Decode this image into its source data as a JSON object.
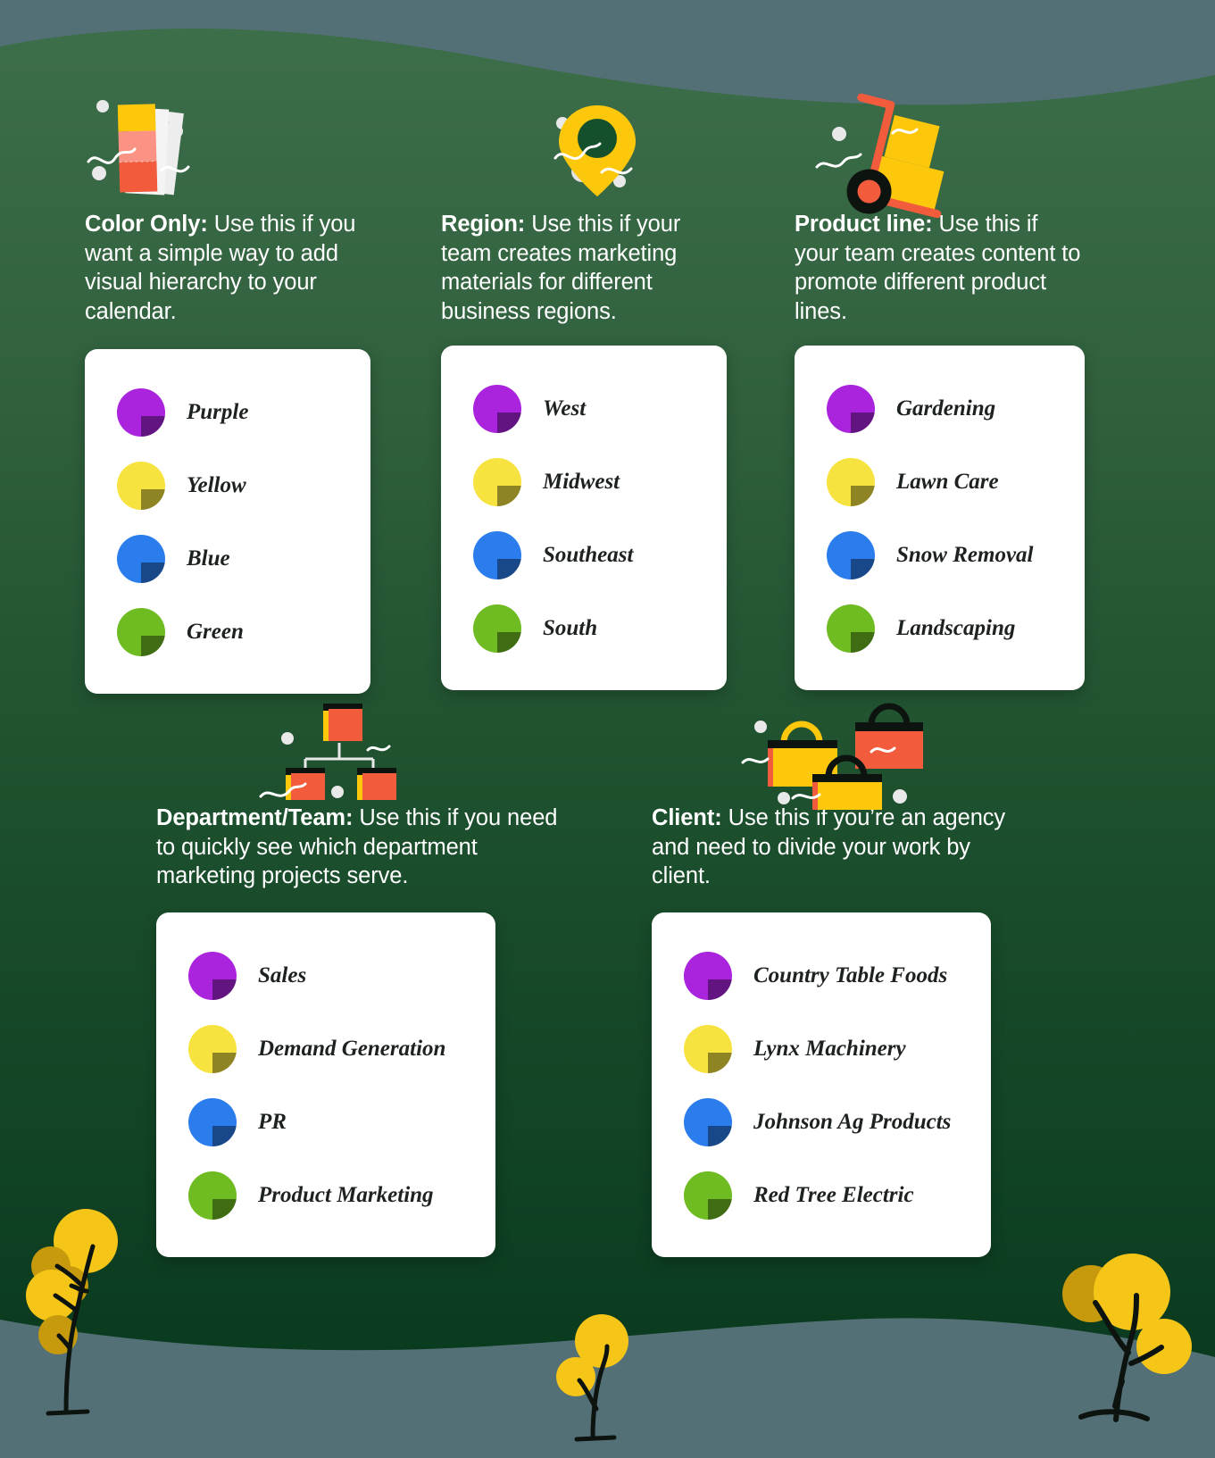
{
  "colors": {
    "background_top": "#547077",
    "hill_top": "#3a6b48",
    "hill_bottom": "#0b3c20",
    "card_background": "#ffffff",
    "text": "#ffffff",
    "label_text": "#1d2220",
    "swatch_purple": "#a924dc",
    "swatch_yellow": "#f7e33f",
    "swatch_blue": "#2b7ded",
    "swatch_green": "#6fbb22",
    "accent_yellow": "#fdc70c",
    "accent_orange": "#f25b3c",
    "accent_salmon": "#fb9384",
    "accent_paper": "#ededed",
    "plant_yellow": "#f5c518",
    "plant_yellow_dark": "#c79a0e",
    "stem": "#0d140f"
  },
  "sections": [
    {
      "id": "color-only",
      "icon": "color-swatch-icon",
      "title": "Color Only:",
      "body": "Use this if you want a simple way to add visual hierarchy to your calendar.",
      "legend": [
        {
          "label": "Purple",
          "color": "#a924dc"
        },
        {
          "label": "Yellow",
          "color": "#f7e33f"
        },
        {
          "label": "Blue",
          "color": "#2b7ded"
        },
        {
          "label": "Green",
          "color": "#6fbb22"
        }
      ]
    },
    {
      "id": "region",
      "icon": "map-pin-icon",
      "title": "Region:",
      "body": "Use this if your team creates marketing materials for different business regions.",
      "legend": [
        {
          "label": "West",
          "color": "#a924dc"
        },
        {
          "label": "Midwest",
          "color": "#f7e33f"
        },
        {
          "label": "Southeast",
          "color": "#2b7ded"
        },
        {
          "label": "South",
          "color": "#6fbb22"
        }
      ]
    },
    {
      "id": "product-line",
      "icon": "hand-truck-icon",
      "title": "Product line:",
      "body": "Use this if your team creates content to promote different product lines.",
      "legend": [
        {
          "label": "Gardening",
          "color": "#a924dc"
        },
        {
          "label": "Lawn Care",
          "color": "#f7e33f"
        },
        {
          "label": "Snow Removal",
          "color": "#2b7ded"
        },
        {
          "label": "Landscaping",
          "color": "#6fbb22"
        }
      ]
    },
    {
      "id": "department-team",
      "icon": "org-chart-icon",
      "title": "Department/Team:",
      "body": "Use this if you need to quickly see which department marketing projects serve.",
      "legend": [
        {
          "label": "Sales",
          "color": "#a924dc"
        },
        {
          "label": "Demand Generation",
          "color": "#f7e33f"
        },
        {
          "label": "PR",
          "color": "#2b7ded"
        },
        {
          "label": "Product Marketing",
          "color": "#6fbb22"
        }
      ]
    },
    {
      "id": "client",
      "icon": "shopping-bags-icon",
      "title": "Client:",
      "body": "Use this if you’re an agency and need to divide your work by client.",
      "legend": [
        {
          "label": "Country Table Foods",
          "color": "#a924dc"
        },
        {
          "label": "Lynx Machinery",
          "color": "#f7e33f"
        },
        {
          "label": "Johnson Ag Products",
          "color": "#2b7ded"
        },
        {
          "label": "Red Tree Electric",
          "color": "#6fbb22"
        }
      ]
    }
  ],
  "decorations": {
    "plants": [
      "plant-bottom-left",
      "plant-bottom-center",
      "plant-bottom-right"
    ]
  }
}
